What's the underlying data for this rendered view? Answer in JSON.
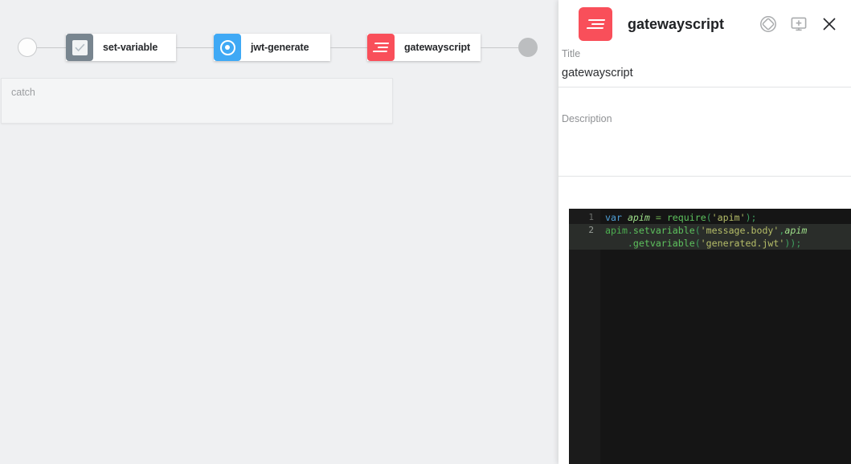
{
  "canvas": {
    "start_node_name": "start-circle",
    "end_node_name": "end-circle",
    "nodes": [
      {
        "id": "set-variable",
        "label": "set-variable",
        "icon": "check-box-icon",
        "color": "#78858f"
      },
      {
        "id": "jwt-generate",
        "label": "jwt-generate",
        "icon": "target-icon",
        "color": "#3fa9f5"
      },
      {
        "id": "gatewayscript",
        "label": "gatewayscript",
        "icon": "script-lines-icon",
        "color": "#f94f5a"
      }
    ],
    "catch": {
      "label": "catch"
    }
  },
  "panel": {
    "header": {
      "icon": "script-lines-icon",
      "icon_color": "#f94f5a",
      "title": "gatewayscript",
      "actions": [
        {
          "name": "toggle-view-icon",
          "label": ""
        },
        {
          "name": "add-to-screen-icon",
          "label": ""
        },
        {
          "name": "close-icon",
          "label": ""
        }
      ]
    },
    "fields": {
      "title": {
        "label": "Title",
        "value": "gatewayscript",
        "placeholder": "Title"
      },
      "description": {
        "label": "Description",
        "value": "",
        "placeholder": ""
      }
    },
    "editor": {
      "line_numbers": [
        "1",
        "2"
      ],
      "lines": [
        {
          "number": "1",
          "active": false,
          "tokens": [
            {
              "text": "var",
              "type": "kw"
            },
            {
              "text": " ",
              "type": "plain"
            },
            {
              "text": "apim",
              "type": "var"
            },
            {
              "text": " ",
              "type": "plain"
            },
            {
              "text": "=",
              "type": "op"
            },
            {
              "text": " ",
              "type": "plain"
            },
            {
              "text": "require",
              "type": "fn"
            },
            {
              "text": "(",
              "type": "punct"
            },
            {
              "text": "'apim'",
              "type": "str"
            },
            {
              "text": ")",
              "type": "punct"
            },
            {
              "text": ";",
              "type": "punct"
            }
          ]
        },
        {
          "number": "2",
          "active": true,
          "tokens": [
            {
              "text": "apim",
              "type": "plain"
            },
            {
              "text": ".",
              "type": "punct"
            },
            {
              "text": "setvariable",
              "type": "fn"
            },
            {
              "text": "(",
              "type": "punct"
            },
            {
              "text": "'message.body'",
              "type": "str"
            },
            {
              "text": ",",
              "type": "punct"
            },
            {
              "text": "apim",
              "type": "var"
            }
          ]
        },
        {
          "number": "",
          "active": true,
          "tokens": [
            {
              "text": "    .",
              "type": "punct"
            },
            {
              "text": "getvariable",
              "type": "fn"
            },
            {
              "text": "(",
              "type": "punct"
            },
            {
              "text": "'generated.jwt'",
              "type": "str"
            },
            {
              "text": "))",
              "type": "punct"
            },
            {
              "text": ";",
              "type": "punct"
            }
          ]
        }
      ],
      "raw_code": "var apim = require('apim');\napim.setvariable('message.body',apim\n    .getvariable('generated.jwt'));"
    }
  },
  "colors": {
    "canvas_background": "#eff0f2",
    "panel_background": "#ffffff",
    "accent_red": "#f94f5a",
    "accent_blue": "#3fa9f5",
    "accent_gray": "#78858f",
    "editor_background": "#151515",
    "editor_active_line": "#2a2d2a"
  }
}
